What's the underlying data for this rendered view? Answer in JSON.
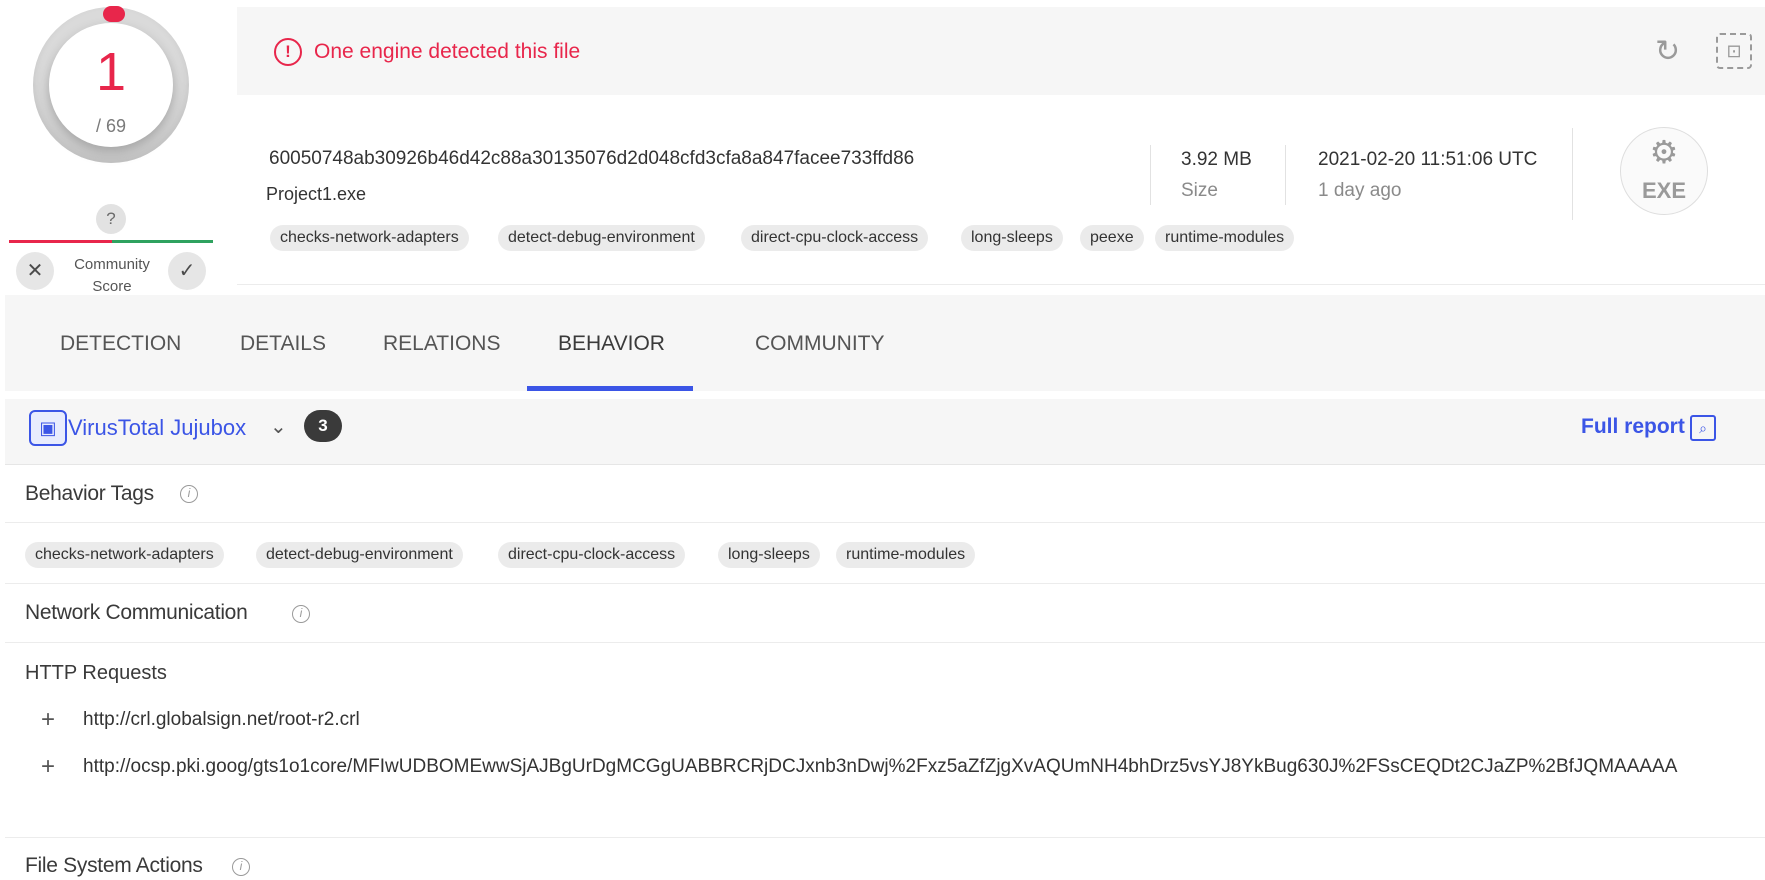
{
  "score": {
    "detections": "1",
    "total": "/ 69"
  },
  "community": {
    "unknown": "?",
    "label_line1": "Community",
    "label_line2": "Score",
    "down": "✕",
    "up": "✓"
  },
  "alert": {
    "icon": "!",
    "text": "One engine detected this file"
  },
  "file": {
    "hash": "60050748ab30926b46d42c88a30135076d2d048cfd3cfa8a847facee733ffd86",
    "name": "Project1.exe",
    "size_value": "3.92 MB",
    "size_label": "Size",
    "date_value": "2021-02-20 11:51:06 UTC",
    "date_relative": "1 day ago",
    "type_badge": "EXE",
    "tags": [
      "checks-network-adapters",
      "detect-debug-environment",
      "direct-cpu-clock-access",
      "long-sleeps",
      "peexe",
      "runtime-modules"
    ]
  },
  "tabs": [
    {
      "label": "DETECTION"
    },
    {
      "label": "DETAILS"
    },
    {
      "label": "RELATIONS"
    },
    {
      "label": "BEHAVIOR"
    },
    {
      "label": "COMMUNITY"
    }
  ],
  "active_tab": "BEHAVIOR",
  "sandbox": {
    "name": "VirusTotal Jujubox",
    "count": "3",
    "full_report": "Full report"
  },
  "behavior_tags": {
    "title": "Behavior Tags",
    "tags": [
      "checks-network-adapters",
      "detect-debug-environment",
      "direct-cpu-clock-access",
      "long-sleeps",
      "runtime-modules"
    ]
  },
  "network": {
    "title": "Network Communication",
    "http_title": "HTTP Requests",
    "requests": [
      "http://crl.globalsign.net/root-r2.crl",
      "http://ocsp.pki.goog/gts1o1core/MFIwUDBOMEwwSjAJBgUrDgMCGgUABBRCRjDCJxnb3nDwj%2Fxz5aZfZjgXvAQUmNH4bhDrz5vsYJ8YkBug630J%2FSsCEQDt2CJaZP%2BfJQMAAAAA"
    ]
  },
  "file_system": {
    "title": "File System Actions"
  },
  "icons": {
    "info": "i",
    "plus": "+",
    "chevron": "⌄",
    "reanalyze": "↻",
    "similar": "⊡",
    "gears": "⚙",
    "cube": "▣",
    "report": "⌕"
  }
}
